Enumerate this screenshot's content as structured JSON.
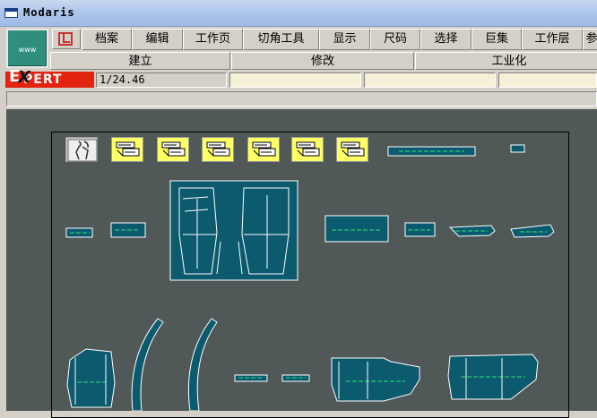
{
  "window": {
    "title": "Modaris"
  },
  "logo": {
    "text": "www"
  },
  "menu": [
    "档案",
    "编辑",
    "工作页",
    "切角工具",
    "显示",
    "尺码",
    "选择",
    "巨集",
    "工作层",
    "参"
  ],
  "submenu": [
    "建立",
    "修改",
    "工业化"
  ],
  "status": {
    "mode_label": "PERT",
    "mode_e": "E",
    "mode_x": "X",
    "scale": "1/24.46"
  },
  "colors": {
    "canvas_bg": "#515958",
    "piece_fill": "#0b5a6e",
    "piece_line": "#ffffff",
    "grain_line": "#33dd77",
    "expert_red": "#e1230f",
    "tool_yellow": "#ffff66"
  },
  "tools": [
    {
      "icon": "figure-icon"
    },
    {
      "icon": "size-tool-icon"
    },
    {
      "icon": "size-tool-icon"
    },
    {
      "icon": "size-tool-icon"
    },
    {
      "icon": "size-tool-icon"
    },
    {
      "icon": "size-tool-icon"
    },
    {
      "icon": "size-tool-icon"
    }
  ]
}
